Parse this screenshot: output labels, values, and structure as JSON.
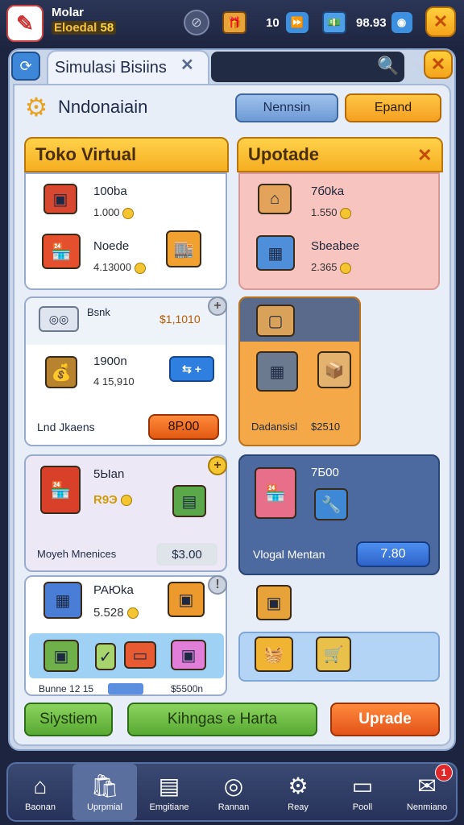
{
  "header": {
    "player_name": "Molar",
    "player_sub": "Eloedal",
    "level_badge": "58",
    "res1": "10",
    "res2": "98.93"
  },
  "tab": {
    "title": "Simulasi Bisiins"
  },
  "section": {
    "title": "Nndonaiain",
    "btn1": "Nennsin",
    "btn2": "Epand"
  },
  "toko": {
    "title": "Toko Virtual",
    "item1_name": "100ba",
    "item1_price": "1.000",
    "item2_name": "Noede",
    "item2_price": "4.13000"
  },
  "upgrade": {
    "title": "Upotade",
    "item1_name": "7б0ka",
    "item1_price": "1.550",
    "item2_name": "Sbeabee",
    "item2_price": "2.365"
  },
  "bank": {
    "name": "Bsnk",
    "price": "$1,1010",
    "sub_name": "1900n",
    "sub_price": "4 15,910",
    "label": "Lnd Jkaens",
    "btn": "8Р.00"
  },
  "orange_card": {
    "label": "Dadansisl",
    "price": "$2510"
  },
  "card3": {
    "name": "5Ыаn",
    "price": "R9Э",
    "label": "Moyeh Mnenices",
    "value": "$3.00"
  },
  "blue_card": {
    "name": "7Б00",
    "label": "Vlogal Mentan",
    "btn": "7.80"
  },
  "card4": {
    "name": "PAЮka",
    "price": "5.528",
    "footer_left": "Bunne 12 15",
    "footer_right": "$5500n"
  },
  "bottom_buttons": {
    "b1": "Siystiem",
    "b2": "Kihngas e Harta",
    "b3": "Uprade"
  },
  "nav": [
    {
      "label": "Baonan",
      "icon": "home-icon"
    },
    {
      "label": "Uprpmial",
      "icon": "shop-bag-icon"
    },
    {
      "label": "Emgitiane",
      "icon": "board-icon"
    },
    {
      "label": "Rannan",
      "icon": "coin-stack-icon"
    },
    {
      "label": "Reay",
      "icon": "gear-icon"
    },
    {
      "label": "Pooll",
      "icon": "card-icon"
    },
    {
      "label": "Nenmiano",
      "icon": "message-icon"
    }
  ],
  "nav_badge": "1",
  "colors": {
    "accent_orange": "#f5a020",
    "accent_blue": "#6d9ad5",
    "accent_green": "#6cc24a"
  }
}
